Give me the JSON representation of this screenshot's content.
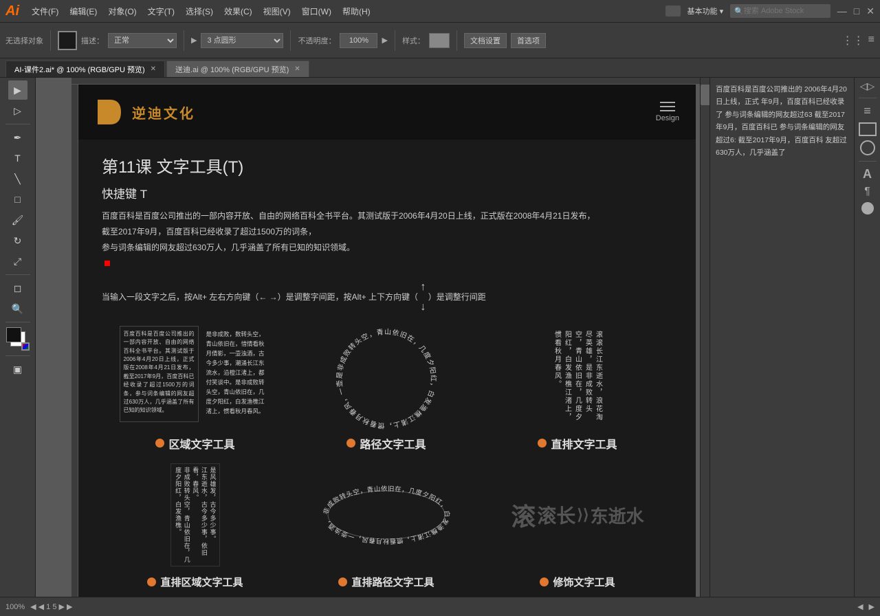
{
  "app": {
    "logo": "Ai",
    "logo_color": "#ff6a00"
  },
  "menu": {
    "items": [
      "文件(F)",
      "编辑(E)",
      "对象(O)",
      "文字(T)",
      "选择(S)",
      "效果(C)",
      "视图(V)",
      "窗口(W)",
      "帮助(H)"
    ],
    "right": [
      "基本功能 ▾",
      "搜索 Adobe Stock"
    ]
  },
  "toolbar": {
    "no_select": "无选择对象",
    "blend": "描述：",
    "point_label": "▶ 3 点圆形",
    "opacity_label": "不透明度：",
    "opacity_value": "100%",
    "style_label": "样式：",
    "doc_settings": "文档设置",
    "preferences": "首选项"
  },
  "tabs": [
    {
      "label": "AI-课件2.ai* @ 100% (RGB/GPU 预览)",
      "active": true
    },
    {
      "label": "送迪.ai @ 100% (RGB/GPU 预览)",
      "active": false
    }
  ],
  "artboard": {
    "brand": "逆迪文化",
    "brand_abbr": "D",
    "design_label": "Design",
    "lesson_title": "第11课   文字工具(T)",
    "shortcut": "快捷键 T",
    "description_lines": [
      "百度百科是百度公司推出的一部内容开放、自由的网络百科全书平台。其测试版于2006年4月20日上线，正式版在2008年4月21日发布，",
      "截至2017年9月，百度百科已经收录了超过1500万的词条，",
      "参与词条编辑的网友超过630万人，几乎涵盖了所有已知的知识领域。"
    ],
    "tip": "当输入一段文字之后，按Alt+ 左右方向键（← →）是调整字间距，按Alt+ 上下方向键（↑ ↓）是调整行间距",
    "tools": [
      {
        "id": "area-text",
        "label": "区域文字工具",
        "sample_text": "百度百科是百度公司推出的一部内容开放、自由的网络百科全书平台。其测试版于2006年4月20日上线，正式版在2008年4月21日发布，截至2017年9月，百度百科已经收录了超过1500万的词条，参与词条编辑的网友超过630万人，几乎涵盖了所有已知的知识领域。"
      },
      {
        "id": "path-text",
        "label": "路径文字工具",
        "sample_text": "是非成败转头空，青山依旧在，几度夕阳红，白发渔樵江渚上，惯看秋月春风。"
      },
      {
        "id": "vertical-text",
        "label": "直排文字工具",
        "sample_text": "滚滚长江东逝水，浪花淘尽英雄，是非成败转头空，青山依旧在。"
      }
    ],
    "tools_row2": [
      {
        "id": "vertical-area",
        "label": "直排区域文字工具"
      },
      {
        "id": "vertical-path",
        "label": "直排路径文字工具"
      },
      {
        "id": "decoration",
        "label": "修饰文字工具"
      }
    ]
  },
  "right_preview": {
    "text": "百度百科是百度公司推出的 2006年4月20日上线，正式 年9月，百度百科已经收录了 参与词条编辑的网友超过63 截至2017年9月，百度百科已 参与词条编辑的网友超过6: 截至2017年9月，百度百科 友超过630万人，几乎涵盖了"
  },
  "bottom_bar": {
    "zoom": "100%",
    "page_info": "◀ ◀ 1  5  ▶ ▶"
  }
}
